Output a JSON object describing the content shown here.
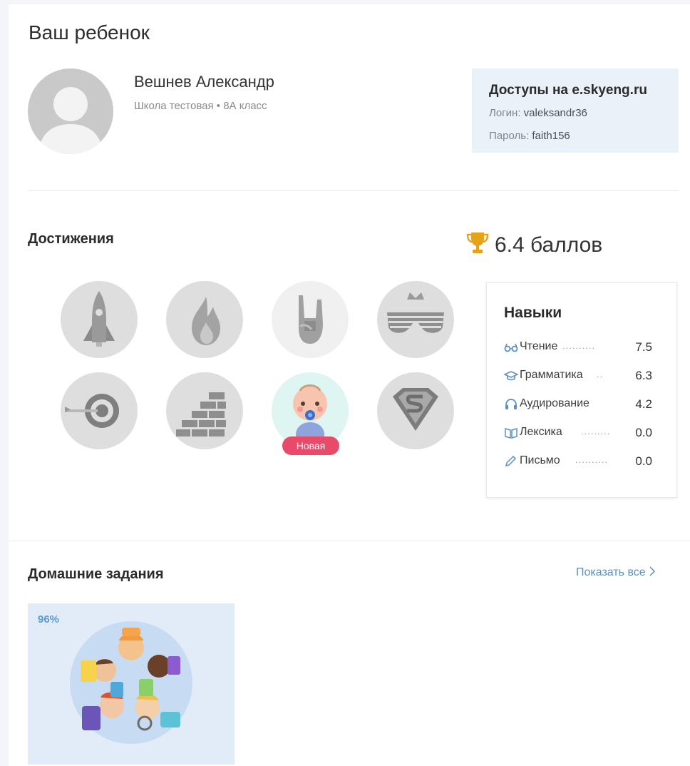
{
  "page": {
    "title": "Ваш ребенок"
  },
  "child": {
    "name": "Вешнев Александр",
    "school": "Школа тестовая • 8А класс"
  },
  "access": {
    "title": "Доступы на e.skyeng.ru",
    "login_label": "Логин:",
    "login_value": "valeksandr36",
    "password_label": "Пароль:",
    "password_value": "faith156"
  },
  "achievements": {
    "title": "Достижения",
    "score_text": "6.4 баллов",
    "badges": [
      {
        "icon": "rocket-icon"
      },
      {
        "icon": "flame-icon"
      },
      {
        "icon": "rock-hand-icon"
      },
      {
        "icon": "shutter-shades-icon"
      },
      {
        "icon": "target-icon"
      },
      {
        "icon": "brick-wall-icon"
      },
      {
        "icon": "baby-icon",
        "tag": "Новая"
      },
      {
        "icon": "superman-shield-icon"
      }
    ]
  },
  "skills": {
    "title": "Навыки",
    "items": [
      {
        "icon": "glasses-icon",
        "label": "Чтение",
        "dots": "..........",
        "value": "7.5"
      },
      {
        "icon": "graduation-cap-icon",
        "label": "Грамматика",
        "dots": "..",
        "value": "6.3"
      },
      {
        "icon": "headphones-icon",
        "label": "Аудирование",
        "dots": "",
        "value": "4.2"
      },
      {
        "icon": "book-icon",
        "label": "Лексика",
        "dots": ".........",
        "value": "0.0"
      },
      {
        "icon": "pencil-icon",
        "label": "Письмо",
        "dots": "..........",
        "value": "0.0"
      }
    ]
  },
  "homework": {
    "title": "Домашние задания",
    "show_all": "Показать все",
    "items": [
      {
        "progress": "96%",
        "progress_value": 0.96
      }
    ]
  }
}
